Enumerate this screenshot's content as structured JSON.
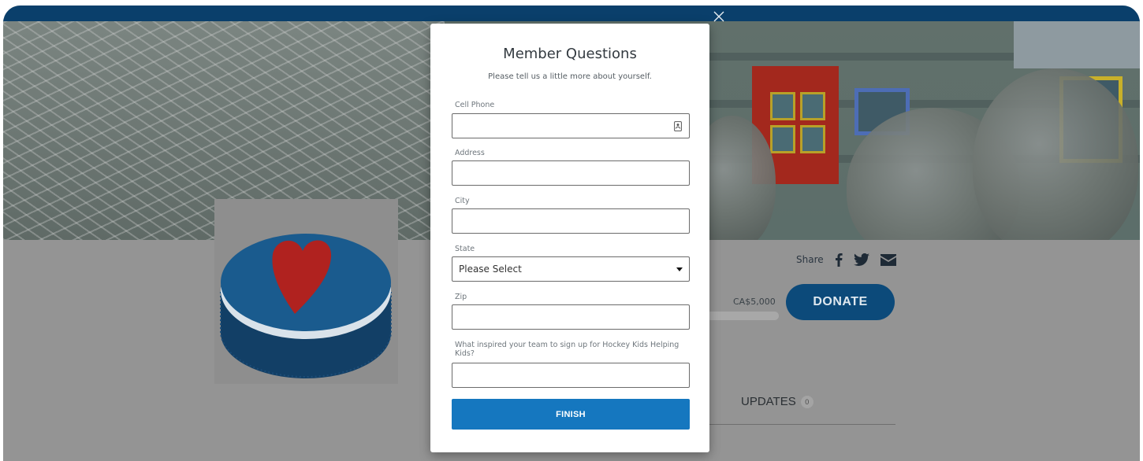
{
  "background": {
    "share_label": "Share",
    "goal_amount": "CA$5,000",
    "goal_progress_fraction": 0.0,
    "donate_label": "DONATE",
    "updates_tab_label": "UPDATES",
    "updates_count": "0"
  },
  "modal": {
    "title": "Member Questions",
    "subtitle": "Please tell us a little more about yourself.",
    "fields": {
      "cell_phone": {
        "label": "Cell Phone",
        "value": ""
      },
      "address": {
        "label": "Address",
        "value": ""
      },
      "city": {
        "label": "City",
        "value": ""
      },
      "state": {
        "label": "State",
        "selected": "Please Select"
      },
      "zip": {
        "label": "Zip",
        "value": ""
      },
      "inspiration": {
        "label": "What inspired your team to sign up for Hockey Kids Helping Kids?",
        "value": ""
      }
    },
    "finish_label": "FINISH"
  },
  "icons": {
    "close": "close-icon",
    "facebook": "facebook-icon",
    "twitter": "twitter-icon",
    "email": "envelope-icon",
    "contact_card": "contact-card-icon",
    "dropdown": "chevron-down-icon",
    "logo": "heart-puck-logo"
  },
  "colors": {
    "header_bar": "#0a3f6b",
    "donate_button": "#0c4a7a",
    "finish_button": "#1577bf",
    "overlay_gray": "#949494"
  }
}
